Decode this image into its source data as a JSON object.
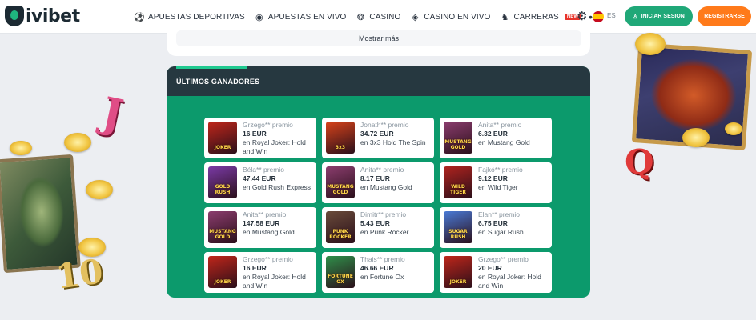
{
  "brand": {
    "logo_text": "ivibet"
  },
  "nav": {
    "items": [
      {
        "label": "APUESTAS DEPORTIVAS",
        "icon": "soccer-ball-icon"
      },
      {
        "label": "APUESTAS EN VIVO",
        "icon": "live-ball-icon"
      },
      {
        "label": "CASINO",
        "icon": "roulette-icon"
      },
      {
        "label": "CASINO EN VIVO",
        "icon": "live-casino-icon"
      },
      {
        "label": "CARRERAS",
        "icon": "horse-icon",
        "badge": "NEW"
      }
    ],
    "more_icon": "more-dots-icon"
  },
  "header": {
    "settings_icon": "gear-icon",
    "language": "ES",
    "login_label": "INICIAR SESION",
    "register_label": "REGISTRARSE"
  },
  "top_card": {
    "show_more_label": "Mostrar más"
  },
  "winners": {
    "title": "ÚLTIMOS GANADORES",
    "items": [
      {
        "line": "Grzego** premio",
        "amount": "16 EUR",
        "game": "en Royal Joker: Hold and Win",
        "thumb_label": "JOKER",
        "thumb_color": "#c0261a"
      },
      {
        "line": "Jonath** premio",
        "amount": "34.72 EUR",
        "game": "en 3x3 Hold The Spin",
        "thumb_label": "3x3",
        "thumb_color": "#d8431a"
      },
      {
        "line": "Anita** premio",
        "amount": "6.32 EUR",
        "game": "en Mustang Gold",
        "thumb_label": "MUSTANG GOLD",
        "thumb_color": "#8b3d6e"
      },
      {
        "line": "Béla** premio",
        "amount": "47.44 EUR",
        "game": "en Gold Rush Express",
        "thumb_label": "GOLD RUSH",
        "thumb_color": "#7a3aa6"
      },
      {
        "line": "Anita** premio",
        "amount": "8.17 EUR",
        "game": "en Mustang Gold",
        "thumb_label": "MUSTANG GOLD",
        "thumb_color": "#8b3d6e"
      },
      {
        "line": "Fajkó** premio",
        "amount": "9.12 EUR",
        "game": "en Wild Tiger",
        "thumb_label": "WILD TIGER",
        "thumb_color": "#b0231e"
      },
      {
        "line": "Anita** premio",
        "amount": "147.58 EUR",
        "game": "en Mustang Gold",
        "thumb_label": "MUSTANG GOLD",
        "thumb_color": "#8b3d6e"
      },
      {
        "line": "Dimitr** premio",
        "amount": "5.43 EUR",
        "game": "en Punk Rocker",
        "thumb_label": "PUNK ROCKER",
        "thumb_color": "#6a4b3a"
      },
      {
        "line": "Elan** premio",
        "amount": "6.75 EUR",
        "game": "en Sugar Rush",
        "thumb_label": "SUGAR RUSH",
        "thumb_color": "#4a7ad6"
      },
      {
        "line": "Grzego** premio",
        "amount": "16 EUR",
        "game": "en Royal Joker: Hold and Win",
        "thumb_label": "JOKER",
        "thumb_color": "#c0261a"
      },
      {
        "line": "Thais** premio",
        "amount": "46.66 EUR",
        "game": "en Fortune Ox",
        "thumb_label": "FORTUNE OX",
        "thumb_color": "#2f8f4a"
      },
      {
        "line": "Grzego** premio",
        "amount": "20 EUR",
        "game": "en Royal Joker: Hold and Win",
        "thumb_label": "JOKER",
        "thumb_color": "#c0261a"
      }
    ]
  },
  "decor": {
    "letter_j": "J",
    "letter_q": "Q",
    "letter_10": "10"
  },
  "colors": {
    "accent_green": "#20a878",
    "register_orange": "#ff7a1a",
    "panel_green": "#0c9a6c",
    "panel_header": "#263840"
  }
}
